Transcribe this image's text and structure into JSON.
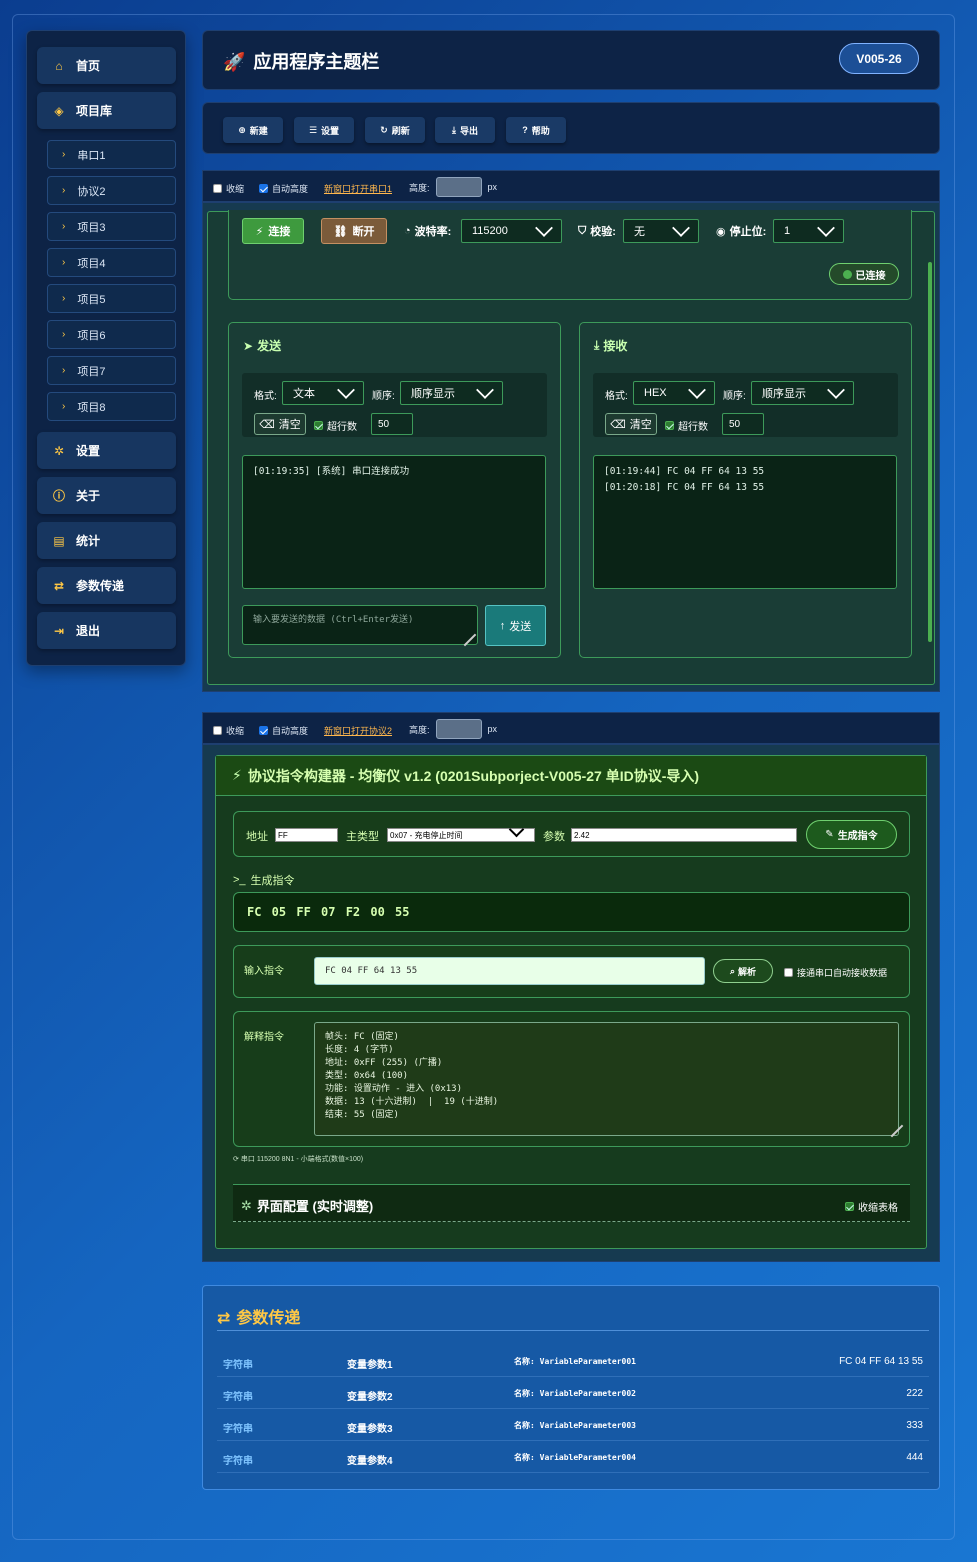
{
  "app": {
    "title": "应用程序主题栏",
    "version": "V005-26"
  },
  "sidebar": {
    "nav_top": [
      {
        "label": "首页",
        "icon": "home-icon"
      },
      {
        "label": "项目库",
        "icon": "cube-icon"
      }
    ],
    "sub_items": [
      "串口1",
      "协议2",
      "项目3",
      "项目4",
      "项目5",
      "项目6",
      "项目7",
      "项目8"
    ],
    "nav_bottom": [
      {
        "label": "设置",
        "icon": "gear-icon"
      },
      {
        "label": "关于",
        "icon": "info-icon"
      },
      {
        "label": "统计",
        "icon": "chart-icon"
      },
      {
        "label": "参数传递",
        "icon": "swap-icon"
      },
      {
        "label": "退出",
        "icon": "logout-icon"
      }
    ]
  },
  "toolbar": {
    "new": "新建",
    "settings": "设置",
    "refresh": "刷新",
    "export": "导出",
    "help": "帮助"
  },
  "panel1": {
    "collapse": "收缩",
    "auto_height": "自动高度",
    "open_link": "新窗口打开串口1",
    "height_label": "高度:",
    "unit": "px",
    "connect": "连接",
    "disconnect": "断开",
    "baud_label": "波特率:",
    "baud_value": "115200",
    "parity_label": "校验:",
    "parity_value": "无",
    "stop_label": "停止位:",
    "stop_value": "1",
    "status": "已连接",
    "send": {
      "title": "发送",
      "format_label": "格式:",
      "format_value": "文本",
      "order_label": "顺序:",
      "order_value": "顺序显示",
      "clear": "清空",
      "overflow_label": "超行数",
      "overflow_value": "50",
      "log": "[01:19:35] [系统] 串口连接成功",
      "input_placeholder": "输入要发送的数据 (Ctrl+Enter发送)",
      "send_button": "发送"
    },
    "recv": {
      "title": "接收",
      "format_label": "格式:",
      "format_value": "HEX",
      "order_label": "顺序:",
      "order_value": "顺序显示",
      "clear": "清空",
      "overflow_label": "超行数",
      "overflow_value": "50",
      "log": "[01:19:44] FC 04 FF 64 13 55\n[01:20:18] FC 04 FF 64 13 55"
    }
  },
  "panel2": {
    "collapse": "收缩",
    "auto_height": "自动高度",
    "open_link": "新窗口打开协议2",
    "height_label": "高度:",
    "unit": "px",
    "title": "协议指令构建器 - 均衡仪 v1.2 (0201Subporject-V005-27 单ID协议-导入)",
    "addr_label": "地址",
    "addr_value": "FF",
    "type_label": "主类型",
    "type_value": "0x07 - 充电停止时间",
    "param_label": "参数",
    "param_value": "2.42",
    "gen_button": "生成指令",
    "gen_section": "生成指令",
    "gen_output": "FC 05 FF 07 F2 00 55",
    "input_label": "输入指令",
    "input_value": "FC 04 FF 64 13 55",
    "parse_button": "解析",
    "auto_recv": "接通串口自动接收数据",
    "explain_label": "解释指令",
    "explain_text": "帧头: FC (固定)\n长度: 4 (字节)\n地址: 0xFF (255) (广播)\n类型: 0x64 (100)\n功能: 设置动作 - 进入 (0x13)\n数据: 13 (十六进制)  |  19 (十进制)\n结束: 55 (固定)",
    "footer_note": "串口 115200 8N1 - 小端格式(数值×100)",
    "config_title": "界面配置 (实时调整)",
    "collapse_table": "收缩表格"
  },
  "params": {
    "title": "参数传递",
    "rows": [
      {
        "type": "字符串",
        "name": "变量参数1",
        "key": "名称: VariableParameter001",
        "value": "FC 04 FF 64 13 55"
      },
      {
        "type": "字符串",
        "name": "变量参数2",
        "key": "名称: VariableParameter002",
        "value": "222"
      },
      {
        "type": "字符串",
        "name": "变量参数3",
        "key": "名称: VariableParameter003",
        "value": "333"
      },
      {
        "type": "字符串",
        "name": "变量参数4",
        "key": "名称: VariableParameter004",
        "value": "444"
      }
    ]
  },
  "colors": {
    "accent": "#ffc845",
    "green": "#3d9a5a",
    "navy": "#0d2346"
  }
}
